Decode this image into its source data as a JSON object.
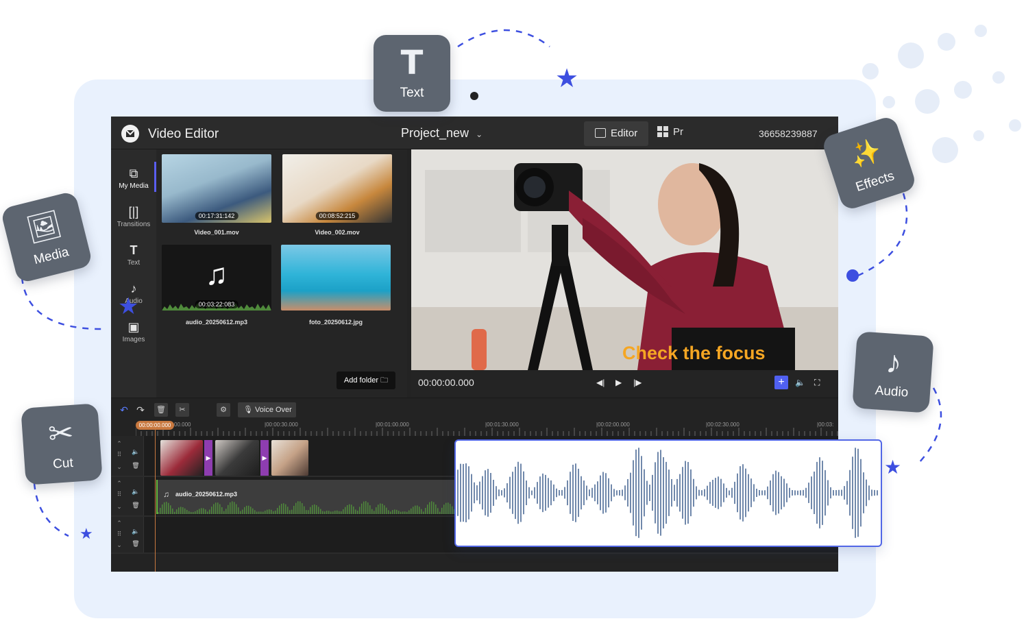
{
  "colors": {
    "accent": "#4f5be0",
    "overlay_text": "#f5a623",
    "playhead": "#c8783f"
  },
  "header": {
    "app_title": "Video Editor",
    "project_name": "Project_new",
    "tab_editor": "Editor",
    "tab_project_partial": "Pr",
    "user_id_partial": "36658239887"
  },
  "sidebar": {
    "items": [
      {
        "label": "My Media",
        "icon": "media-stack-icon"
      },
      {
        "label": "Transitions",
        "icon": "transitions-icon"
      },
      {
        "label": "Text",
        "icon": "text-icon"
      },
      {
        "label": "Audio",
        "icon": "music-note-icon"
      },
      {
        "label": "Images",
        "icon": "image-icon"
      }
    ]
  },
  "media": {
    "items": [
      {
        "name": "Video_001.mov",
        "duration": "00:17:31:142"
      },
      {
        "name": "Video_002.mov",
        "duration": "00:08:52:215"
      },
      {
        "name": "audio_20250612.mp3",
        "duration": "00:03:22:083"
      },
      {
        "name": "foto_20250612.jpg",
        "duration": ""
      }
    ],
    "add_folder": "Add folder"
  },
  "preview": {
    "overlay_text": "Check the focus",
    "timecode": "00:00:00.000"
  },
  "timeline": {
    "voice_over": "Voice Over",
    "playhead": "00:00:00.000",
    "ruler": [
      "00.000",
      "|00:00:30.000",
      "|00:01:00.000",
      "|00:01:30.000",
      "|00:02:00.000",
      "|00:02:30.000",
      "|00:03:"
    ],
    "audio_clip_name": "audio_20250612.mp3"
  },
  "badges": {
    "text": "Text",
    "media": "Media",
    "effects": "Effects",
    "audio": "Audio",
    "cut": "Cut"
  }
}
